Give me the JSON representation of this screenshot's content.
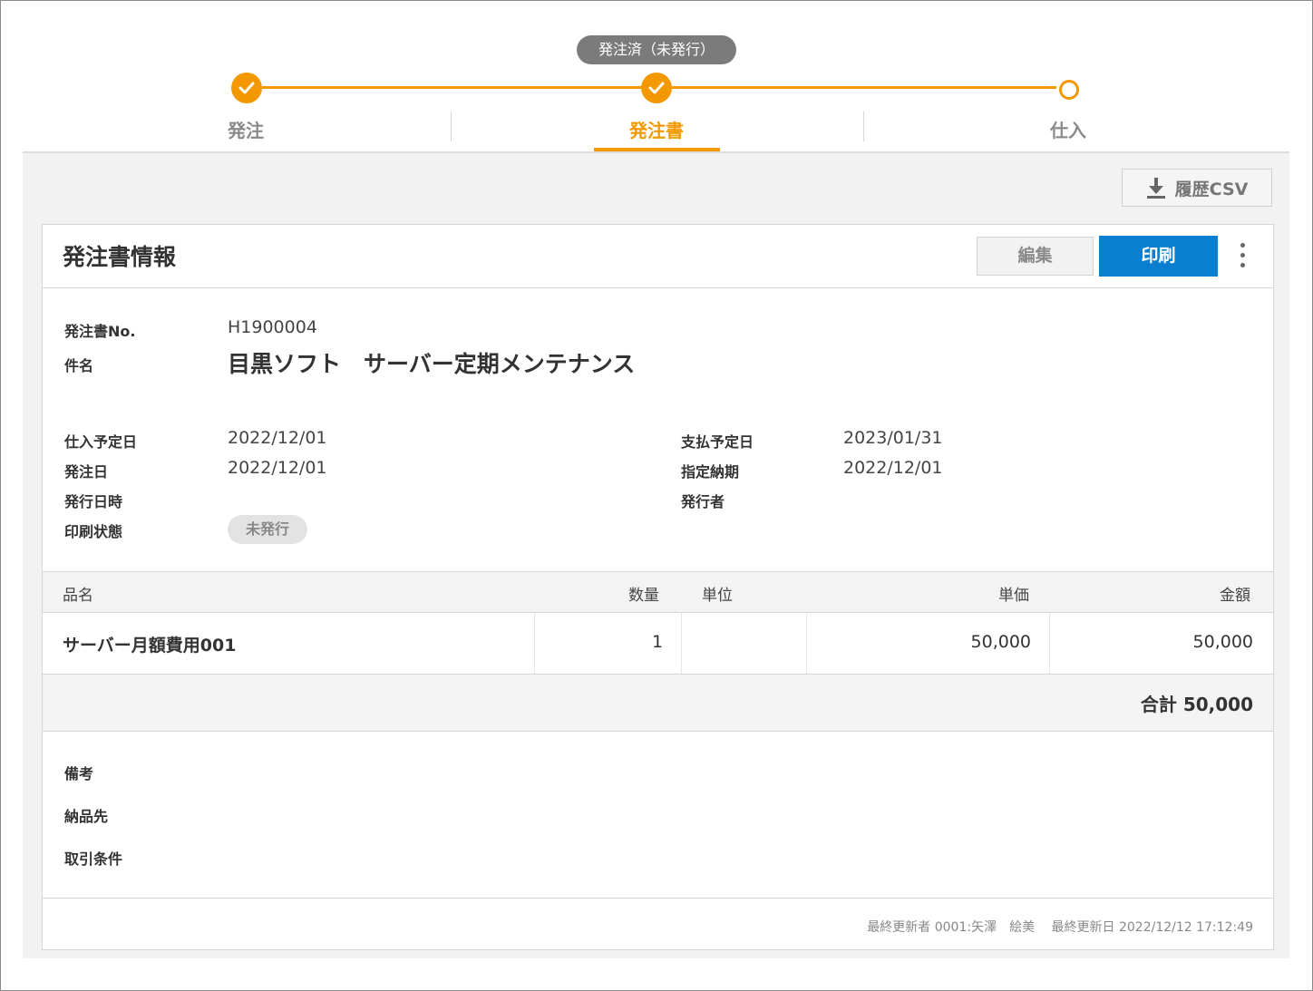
{
  "status_pill": "発注済（未発行）",
  "steps": [
    {
      "label": "発注",
      "state": "done"
    },
    {
      "label": "発注書",
      "state": "done",
      "active": true
    },
    {
      "label": "仕入",
      "state": "open"
    }
  ],
  "colors": {
    "accent": "#f39800",
    "primary": "#0a7fd0"
  },
  "toolbar": {
    "csv_label": "履歴CSV",
    "csv_icon": "download-icon"
  },
  "card": {
    "title": "発注書情報",
    "edit_label": "編集",
    "print_label": "印刷",
    "more_icon": "kebab-menu-icon"
  },
  "fields": {
    "order_no_label": "発注書No.",
    "order_no": "H1900004",
    "subject_label": "件名",
    "subject": "目黒ソフト　サーバー定期メンテナンス",
    "purchase_date_label": "仕入予定日",
    "purchase_date": "2022/12/01",
    "order_date_label": "発注日",
    "order_date": "2022/12/01",
    "issue_datetime_label": "発行日時",
    "issue_datetime": "",
    "print_status_label": "印刷状態",
    "print_status": "未発行",
    "payment_date_label": "支払予定日",
    "payment_date": "2023/01/31",
    "delivery_date_label": "指定納期",
    "delivery_date": "2022/12/01",
    "issuer_label": "発行者",
    "issuer": ""
  },
  "table": {
    "headers": [
      "品名",
      "数量",
      "単位",
      "単価",
      "金額"
    ],
    "rows": [
      {
        "name": "サーバー月額費用001",
        "qty": "1",
        "unit": "",
        "price": "50,000",
        "amount": "50,000"
      }
    ],
    "total": "合計 50,000"
  },
  "notes": {
    "remarks_label": "備考",
    "delivery_to_label": "納品先",
    "terms_label": "取引条件"
  },
  "footer": "最終更新者 0001:矢澤　絵美　 最終更新日 2022/12/12 17:12:49"
}
